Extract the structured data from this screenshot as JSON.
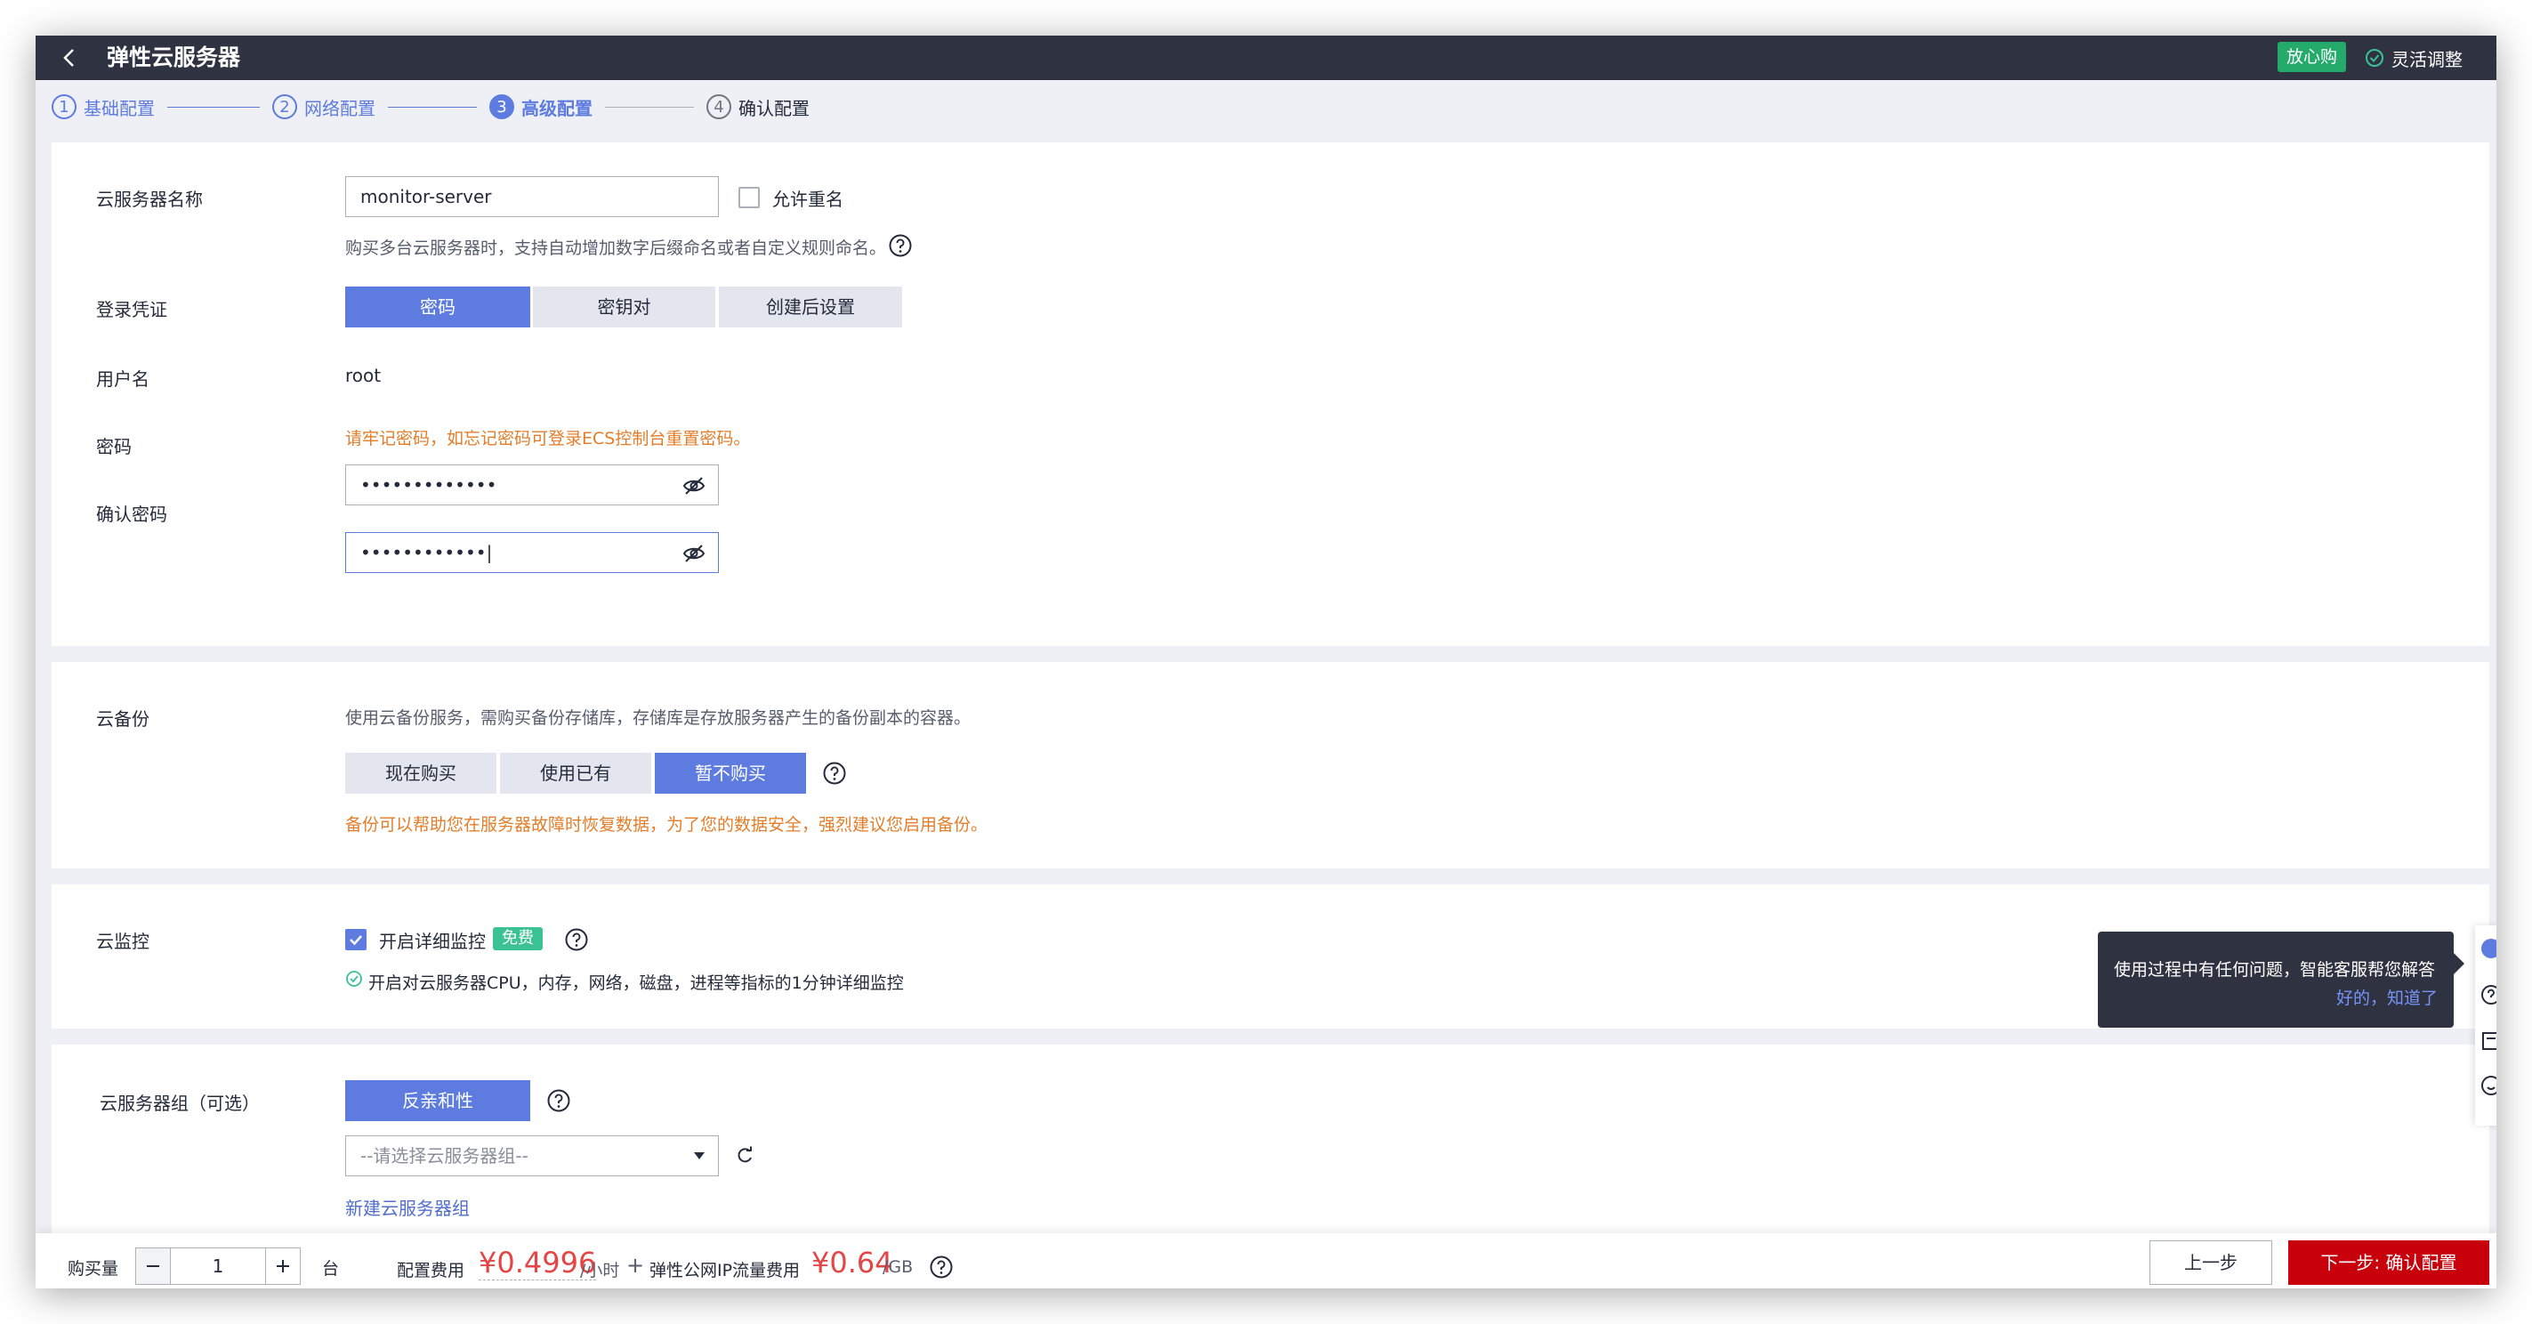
{
  "window": {
    "title": "弹性云服务器",
    "badge": "放心购",
    "flex_adjust": "灵活调整"
  },
  "steps": [
    {
      "num": "1",
      "label": "基础配置",
      "state": "done"
    },
    {
      "num": "2",
      "label": "网络配置",
      "state": "done"
    },
    {
      "num": "3",
      "label": "高级配置",
      "state": "active"
    },
    {
      "num": "4",
      "label": "确认配置",
      "state": "todo"
    }
  ],
  "basic": {
    "name_label": "云服务器名称",
    "name_value": "monitor-server",
    "allow_dup_label": "允许重名",
    "allow_dup_checked": false,
    "name_hint": "购买多台云服务器时，支持自动增加数字后缀命名或者自定义规则命名。",
    "login_label": "登录凭证",
    "login_options": [
      "密码",
      "密钥对",
      "创建后设置"
    ],
    "login_selected": "密码",
    "username_label": "用户名",
    "username_value": "root",
    "password_label": "密码",
    "password_warning": "请牢记密码，如忘记密码可登录ECS控制台重置密码。",
    "password_mask": "•••••••••••••",
    "confirm_label": "确认密码",
    "confirm_mask": "••••••••••••|"
  },
  "backup": {
    "label": "云备份",
    "desc": "使用云备份服务，需购买备份存储库，存储库是存放服务器产生的备份副本的容器。",
    "options": [
      "现在购买",
      "使用已有",
      "暂不购买"
    ],
    "selected": "暂不购买",
    "warning": "备份可以帮助您在服务器故障时恢复数据，为了您的数据安全，强烈建议您启用备份。"
  },
  "monitor": {
    "label": "云监控",
    "checkbox_label": "开启详细监控",
    "checked": true,
    "free_badge": "免费",
    "info": "开启对云服务器CPU，内存，网络，磁盘，进程等指标的1分钟详细监控"
  },
  "group": {
    "label": "云服务器组（可选）",
    "affinity_button": "反亲和性",
    "select_placeholder": "--请选择云服务器组--",
    "create_link": "新建云服务器组"
  },
  "tooltip": {
    "message": "使用过程中有任何问题，智能客服帮您解答",
    "ok": "好的，知道了"
  },
  "footer": {
    "qty_label": "购买量",
    "qty_value": "1",
    "qty_unit": "台",
    "config_fee_label": "配置费用",
    "config_price": "¥0.4996",
    "config_unit": "/小时",
    "plus": "+",
    "ip_fee_label": "弹性公网IP流量费用",
    "ip_price": "¥0.64",
    "ip_unit": "/GB",
    "prev_button": "上一步",
    "next_button": "下一步: 确认配置"
  },
  "colors": {
    "titlebar": "#2f3341",
    "accent": "#5e7ce0",
    "warning": "#e37d29",
    "price": "#e54545",
    "primary_button": "#c7000b",
    "success": "#24ab6c"
  }
}
